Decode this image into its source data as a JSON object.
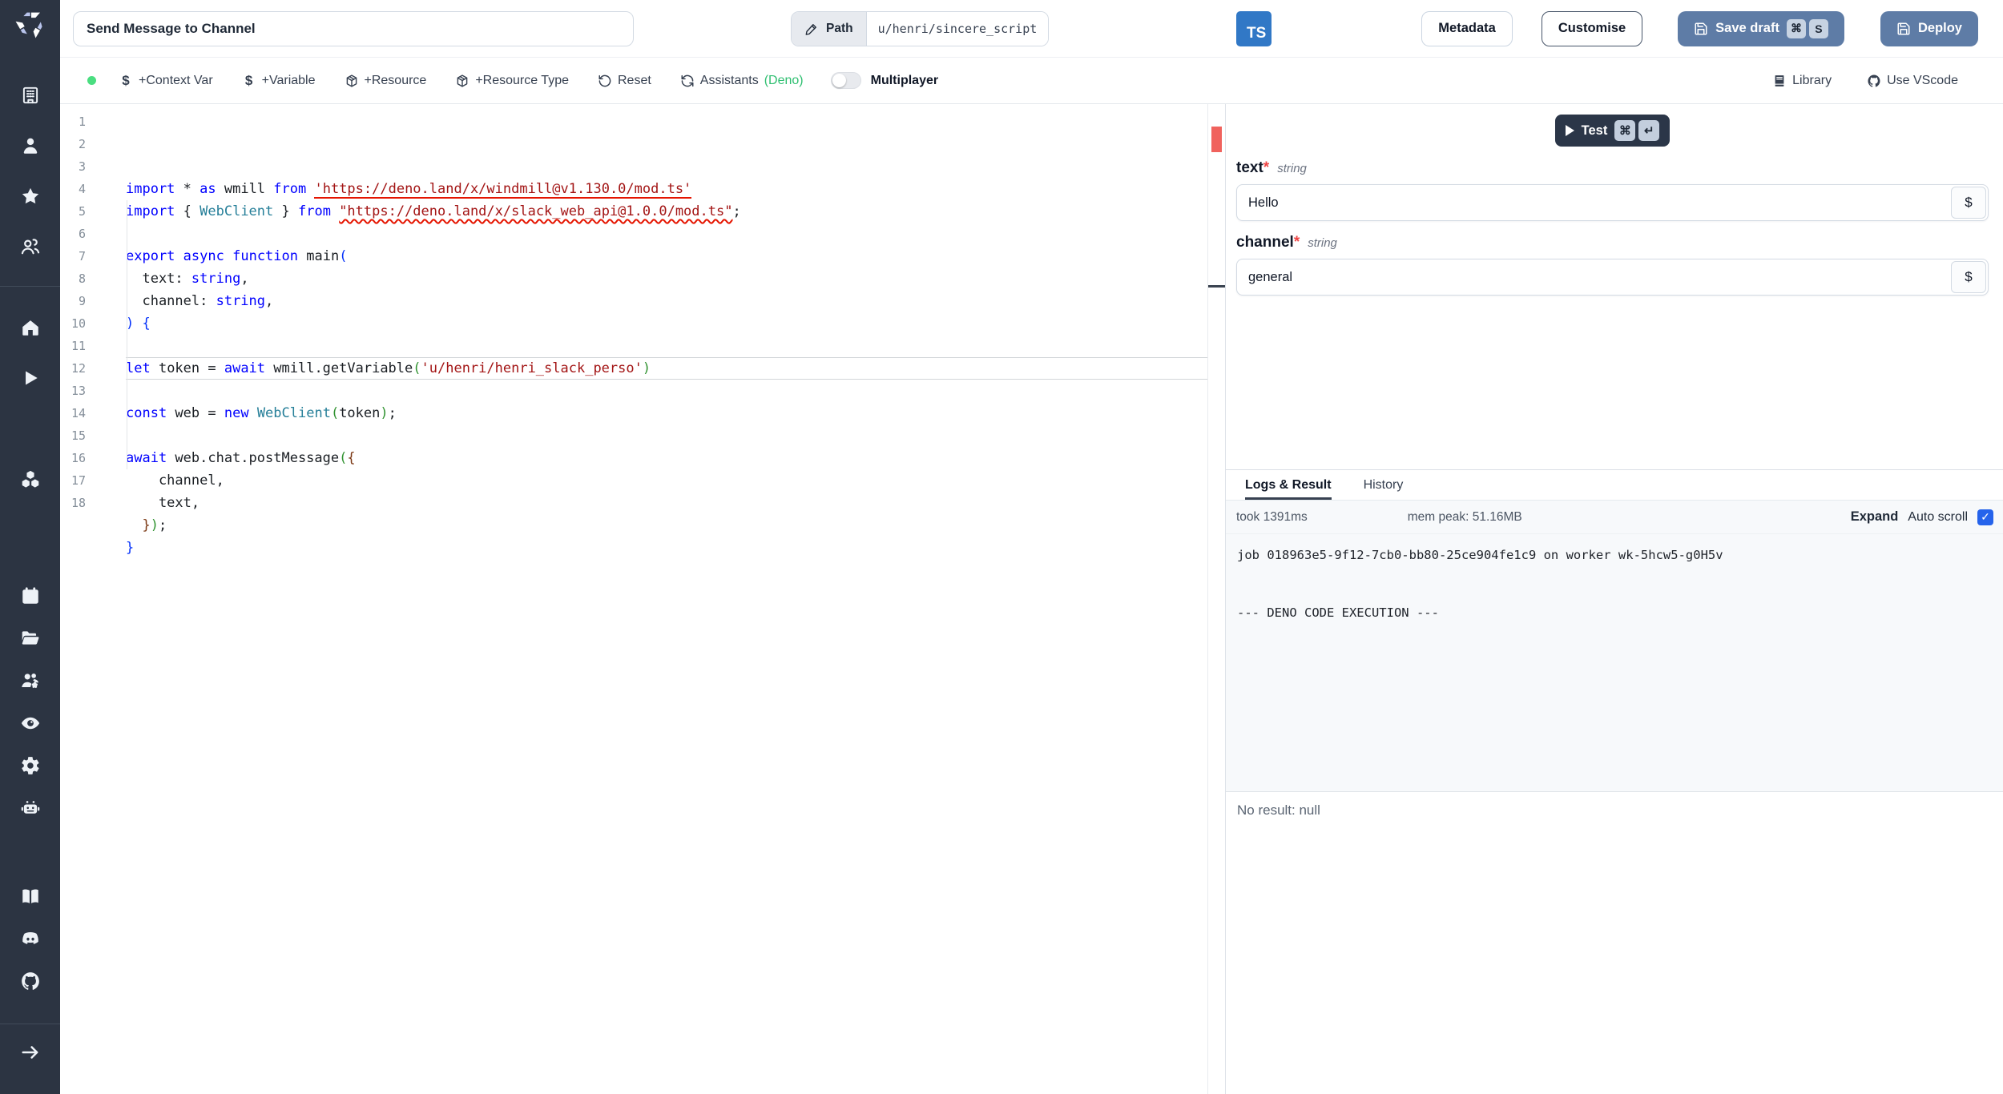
{
  "app": {
    "name": "Windmill"
  },
  "colors": {
    "sidebar_bg": "#2c3442",
    "primary_button": "#5e7ca6",
    "ts_badge": "#3178c6",
    "checkbox": "#2563eb",
    "status_dot": "#4ade80",
    "deno_accent": "#2fbf71",
    "error_marker": "#f0625d",
    "string_error_underline": "#e51400"
  },
  "sidebar": {
    "logo": "windmill-logo",
    "groups": [
      {
        "icons": [
          "building-icon",
          "user-icon",
          "star-icon",
          "users-icon"
        ]
      },
      {
        "icons": [
          "home-icon",
          "play-icon",
          "dollar-icon",
          "boxes-icon"
        ]
      },
      {
        "icons": [
          "calendar-icon",
          "folder-open-icon",
          "users-gear-icon",
          "eye-icon",
          "gear-icon",
          "robot-icon"
        ]
      },
      {
        "icons": [
          "book-icon",
          "discord-icon",
          "github-icon"
        ]
      },
      {
        "icons": [
          "arrow-right-icon"
        ]
      }
    ]
  },
  "topbar": {
    "title_value": "Send Message to Channel",
    "path_label": "Path",
    "path_value": "u/henri/sincere_script",
    "lang_badge": "TS",
    "metadata_label": "Metadata",
    "customise_label": "Customise",
    "save_draft_label": "Save draft",
    "save_draft_kbds": [
      "⌘",
      "S"
    ],
    "deploy_label": "Deploy"
  },
  "toolbar": {
    "status_dot": "green",
    "items": [
      {
        "icon": "dollar-glyph",
        "label": "+Context Var"
      },
      {
        "icon": "dollar-glyph",
        "label": "+Variable"
      },
      {
        "icon": "package-icon",
        "label": "+Resource"
      },
      {
        "icon": "package-icon",
        "label": "+Resource Type"
      },
      {
        "icon": "reset-icon",
        "label": "Reset"
      },
      {
        "icon": "refresh-icon",
        "label": "Assistants",
        "accent": "(Deno)"
      }
    ],
    "multiplayer_toggle": "off",
    "multiplayer_label": "Multiplayer",
    "library_label": "Library",
    "vscode_label": "Use VScode"
  },
  "editor": {
    "language": "typescript",
    "current_line": 9,
    "lines": [
      [
        [
          "k",
          "import"
        ],
        [
          "d",
          " * "
        ],
        [
          "k",
          "as"
        ],
        [
          "d",
          " wmill "
        ],
        [
          "k",
          "from"
        ],
        [
          "d",
          " "
        ],
        [
          "s u1",
          "'https://deno.land/x/windmill@v1.130.0/mod.ts'"
        ]
      ],
      [
        [
          "k",
          "import"
        ],
        [
          "d",
          " { "
        ],
        [
          "t",
          "WebClient"
        ],
        [
          "d",
          " } "
        ],
        [
          "k",
          "from"
        ],
        [
          "d",
          " "
        ],
        [
          "s u2",
          "\"https://deno.land/x/slack_web_api@1.0.0/mod.ts\""
        ],
        [
          "d",
          ";"
        ]
      ],
      [],
      [
        [
          "k",
          "export"
        ],
        [
          "d",
          " "
        ],
        [
          "k",
          "async"
        ],
        [
          "d",
          " "
        ],
        [
          "k",
          "function"
        ],
        [
          "d",
          " main"
        ],
        [
          "b1",
          "("
        ]
      ],
      [
        [
          "d",
          "  text: "
        ],
        [
          "k",
          "string"
        ],
        [
          "d",
          ","
        ]
      ],
      [
        [
          "d",
          "  channel: "
        ],
        [
          "k",
          "string"
        ],
        [
          "d",
          ","
        ]
      ],
      [
        [
          "b1",
          ")"
        ],
        [
          "d",
          " "
        ],
        [
          "b1",
          "{"
        ]
      ],
      [],
      [
        [
          "k",
          "let"
        ],
        [
          "d",
          " token = "
        ],
        [
          "k",
          "await"
        ],
        [
          "d",
          " wmill.getVariable"
        ],
        [
          "b2",
          "("
        ],
        [
          "s",
          "'u/henri/henri_slack_perso'"
        ],
        [
          "b2",
          ")"
        ]
      ],
      [],
      [
        [
          "k",
          "const"
        ],
        [
          "d",
          " web = "
        ],
        [
          "k",
          "new"
        ],
        [
          "d",
          " "
        ],
        [
          "t",
          "WebClient"
        ],
        [
          "b2",
          "("
        ],
        [
          "d",
          "token"
        ],
        [
          "b2",
          ")"
        ],
        [
          "d",
          ";"
        ]
      ],
      [],
      [
        [
          "k",
          "await"
        ],
        [
          "d",
          " web.chat.postMessage"
        ],
        [
          "b2",
          "("
        ],
        [
          "b3",
          "{"
        ]
      ],
      [
        [
          "d",
          "    channel,"
        ]
      ],
      [
        [
          "d",
          "    text,"
        ]
      ],
      [
        [
          "d",
          "  "
        ],
        [
          "b3",
          "}"
        ],
        [
          "b2",
          ")"
        ],
        [
          "d",
          ";"
        ]
      ],
      [
        [
          "b1",
          "}"
        ]
      ],
      []
    ]
  },
  "run_panel": {
    "test_label": "Test",
    "test_kbds": [
      "⌘",
      "↵"
    ],
    "fields": [
      {
        "name": "text",
        "required": "*",
        "type": "string",
        "value": "Hello",
        "dollar": "$"
      },
      {
        "name": "channel",
        "required": "*",
        "type": "string",
        "value": "general",
        "dollar": "$"
      }
    ]
  },
  "logs": {
    "tabs": [
      "Logs & Result",
      "History"
    ],
    "active_tab": 0,
    "took": "took 1391ms",
    "mem": "mem peak: 51.16MB",
    "expand_label": "Expand",
    "autoscroll_label": "Auto scroll",
    "autoscroll_checked": true,
    "checkbox_glyph": "✓",
    "lines": [
      "job 018963e5-9f12-7cb0-bb80-25ce904fe1c9 on worker wk-5hcw5-g0H5v",
      "",
      "",
      "--- DENO CODE EXECUTION ---"
    ]
  },
  "result": {
    "text": "No result: null"
  }
}
